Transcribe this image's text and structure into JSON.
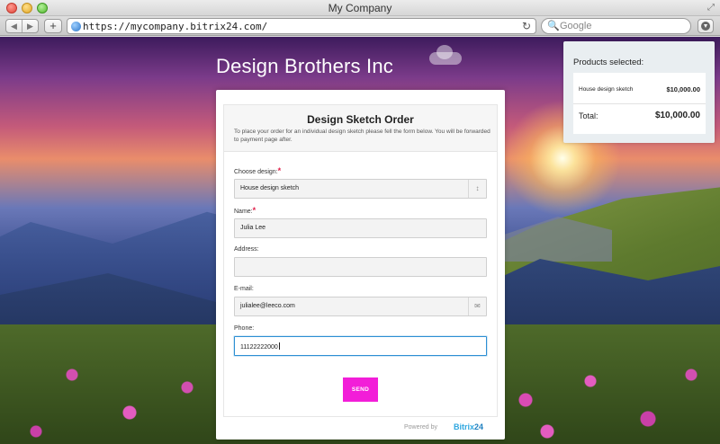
{
  "window": {
    "title": "My Company"
  },
  "browser": {
    "url": "https://mycompany.bitrix24.com/",
    "search_placeholder": "Google",
    "back_glyph": "◀",
    "forward_glyph": "▶",
    "new_tab_glyph": "+",
    "reload_glyph": "↻",
    "resize_glyph": "⤢",
    "search_glyph": "🔍"
  },
  "page": {
    "company_name": "Design Brothers Inc"
  },
  "form": {
    "title": "Design Sketch Order",
    "description": "To place your order for an individual design sketch please fell the form below. You will be forwarded to payment page after.",
    "required_mark": "*",
    "fields": {
      "design": {
        "label": "Choose design:",
        "value": "House design sketch",
        "side_glyph": "↕"
      },
      "name": {
        "label": "Name:",
        "value": "Julia Lee"
      },
      "address": {
        "label": "Address:",
        "value": ""
      },
      "email": {
        "label": "E-mail:",
        "value": "julialee@leeco.com",
        "side_glyph": "✉"
      },
      "phone": {
        "label": "Phone:",
        "value": "11122222000"
      }
    },
    "send_label": "SEND",
    "powered_by": "Powered by",
    "brand_name": "Bitrix",
    "brand_suffix": "24"
  },
  "products": {
    "title": "Products selected:",
    "items": [
      {
        "name": "House design sketch",
        "price": "$10,000.00"
      }
    ],
    "total_label": "Total:",
    "total_value": "$10,000.00"
  },
  "colors": {
    "send_button": "#f21ed8",
    "focus_border": "#2d8fd3",
    "required": "#e0204a",
    "brand": "#2fa7e0"
  }
}
